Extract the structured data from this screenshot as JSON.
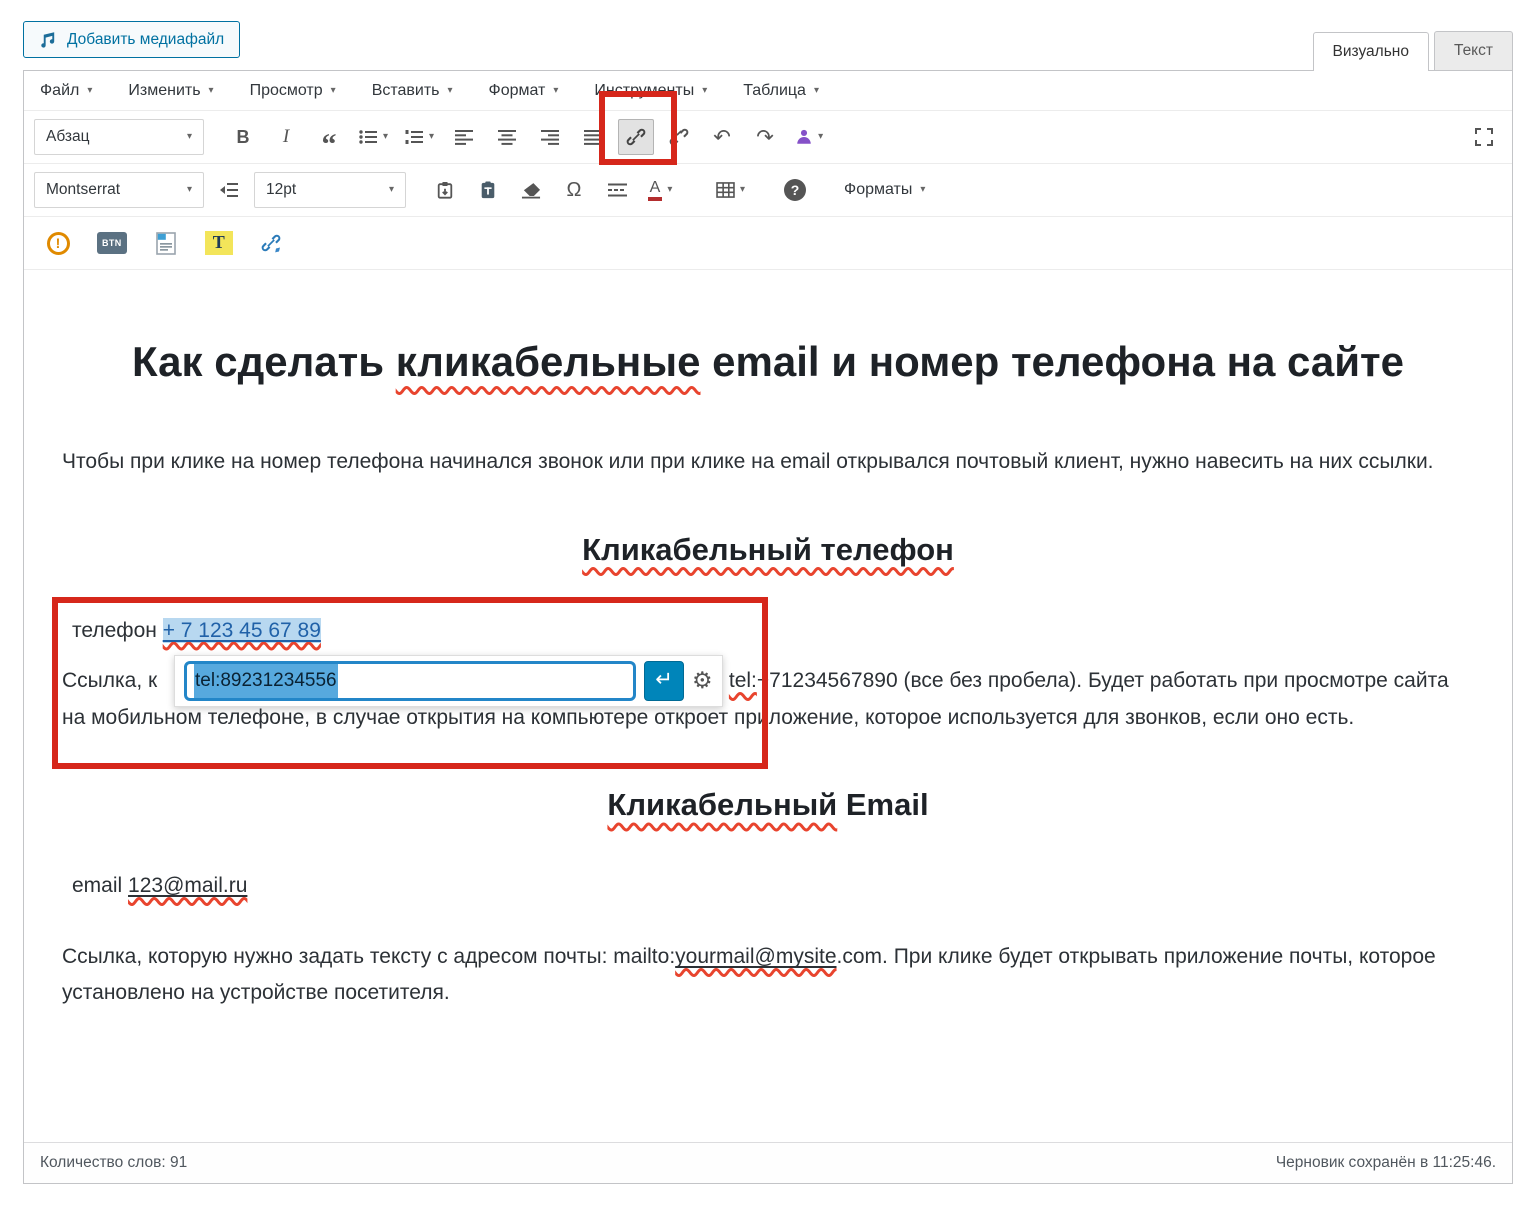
{
  "topbar": {
    "add_media": "Добавить медиафайл",
    "tab_visual": "Визуально",
    "tab_text": "Текст"
  },
  "menubar": {
    "items": [
      "Файл",
      "Изменить",
      "Просмотр",
      "Вставить",
      "Формат",
      "Инструменты",
      "Таблица"
    ]
  },
  "toolbar": {
    "block_select": "Абзац",
    "font_select": "Montserrat",
    "size_select": "12pt",
    "formats": "Форматы",
    "bold": "B",
    "italic": "I",
    "a_letter": "A",
    "help": "?",
    "warning": "!",
    "btn_badge": "BTN",
    "t_badge": "T"
  },
  "glyphs": {
    "caret": "▾",
    "quote": "“",
    "undo": "↶",
    "redo": "↷",
    "omega": "Ω",
    "enter": "↵",
    "gear": "⚙"
  },
  "link_popup": {
    "input_value": "tel:89231234556"
  },
  "content": {
    "title_pre": "Как сделать ",
    "title_marked": "кликабельные",
    "title_post": " email и номер телефона на сайте",
    "intro": "Чтобы при клике на номер телефона начинался звонок или при клике на email открывался почтовый клиент, нужно навесить на них ссылки.",
    "phone_heading": "Кликабельный телефон",
    "phone_label": "телефон ",
    "phone_link": "+ 7 123 45 67 89",
    "phone_para_prefix": "Ссылка, к",
    "phone_para_mid": ": ",
    "phone_para_tel": "tel:",
    "phone_para_suffix": "+71234567890 (все без пробела). Будет работать при просмотре сайта на мобильном телефоне, в случае открытия на компьютере откроет приложение, которое используется для звонков, если оно есть.",
    "email_heading_marked": "Кликабельный",
    "email_heading_rest": " Email",
    "email_label": "email ",
    "email_link": "123@mail.ru",
    "email_para_pre": "Ссылка, которую нужно задать тексту с адресом почты: mailto:",
    "email_para_marked": "yourmail@mysite",
    "email_para_post": ".com. При клике будет открывать приложение почты, которое установлено на устройстве посетителя."
  },
  "statusbar": {
    "word_count": "Количество слов: 91",
    "draft_saved": "Черновик сохранён в 11:25:46."
  },
  "colors": {
    "annotation_red": "#d6271b",
    "link_blue": "#2061a8",
    "accent_blue": "#0085ba",
    "selection_blue": "#57a9de",
    "highlight_blue": "#b8d8f0"
  }
}
